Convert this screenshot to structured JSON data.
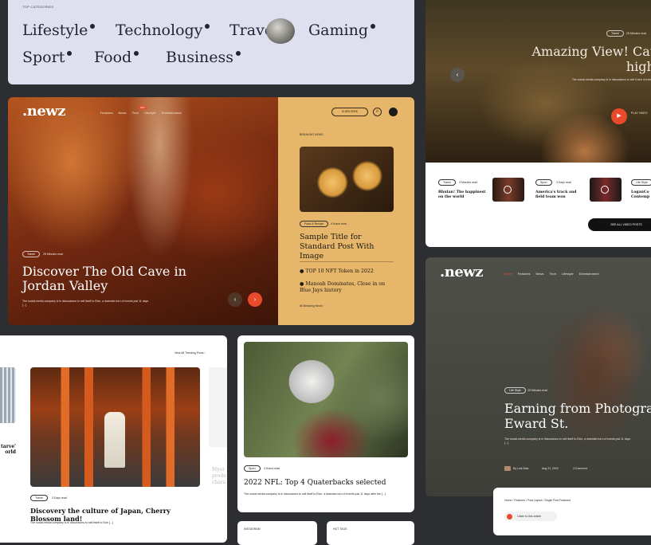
{
  "top_categories": {
    "label": "TOP CATEGORIES",
    "items": [
      "Lifestyle",
      "Technology",
      "Travel",
      "Gaming",
      "Sport",
      "Food",
      "Business"
    ]
  },
  "hero": {
    "logo": ".newz",
    "nav": [
      "Home",
      "Features",
      "News",
      "Tech",
      "Lifestyle",
      "Entertainment"
    ],
    "nav_badge": "HOT",
    "subscribe": "SUBSCRIBE",
    "tag": "Travel",
    "read_time": "25 Minutes read",
    "title": "Discover The Old Cave in Jordan Valley",
    "excerpt": "The social-media company is in discussions to sell itself to Elon, a dramatic turn of events just 11 days [...]",
    "breaking_label": "BREAKING NEWS",
    "breaking_tag": "Food & Recipe",
    "breaking_time": "4 Hours read",
    "breaking_title": "Sample Title for Standard Post With Image",
    "breaking_list": [
      "TOP 10 NFT Token in 2022",
      "Manoah Dominates, Close in on Blue Jays history"
    ],
    "all_breaking": "All Breaking News"
  },
  "video": {
    "title": "Amazing View! Catch in high mou",
    "excerpt": "The social-media company is in discussions to sell it turn of events just 11 days [...]",
    "tag": "Travel",
    "time": "25 Minutes read",
    "play": "PLAY VIDEO",
    "items": [
      {
        "tag": "Travel",
        "time": "3 Minutes read",
        "title": "Bhutan! The happinest on the world"
      },
      {
        "tag": "Sport",
        "time": "3 Days read",
        "title": "America's track and field team won"
      },
      {
        "tag": "Life Style",
        "time": "",
        "title": "LoganCo Contemp"
      }
    ],
    "see_all": "SEE ALL VIDEO POSTS"
  },
  "trending": {
    "view_all": "View All Trending Posts",
    "left_title": "tarve' orld",
    "tag": "Travel",
    "time": "3 Days read",
    "title": "Discovery the culture of Japan, Cherry Blossom land!",
    "excerpt": "The social-media company is in discussions to sell itself to Elon [...]",
    "right_title": "Myer produ chara"
  },
  "football": {
    "tag": "Sport",
    "time": "4 Hours read",
    "title": "2022 NFL: Top 4 Quaterbacks selected",
    "excerpt": "The social-media company is in discussions to sell itself to Elon, a dramatic turn of events just 11 days after the [...]",
    "instagram": "INSTAGRAM",
    "hot_tags": "HOT TAGS"
  },
  "article": {
    "logo": ".newz",
    "nav": [
      "Home",
      "Features",
      "News",
      "Tech",
      "Lifestyle",
      "Entertainment"
    ],
    "tag": "Life Style",
    "time": "25 Minutes read",
    "title": "Earning from Photograph Eward St.",
    "excerpt": "The social-media company is in discussions to sell itself to Elon, a dramatic turn of events just 11 days [...]",
    "author": "By Luis Diaz",
    "date": "Aug 21, 2022",
    "comments": "3 Comment",
    "breadcrumb": "Home / Features / Post Layout / Single Post Featured",
    "listen": "Listen to this article"
  },
  "colors": {
    "accent": "#e94a2b",
    "categories_bg": "#dfe0ef",
    "hero_side": "#e6b66a"
  }
}
